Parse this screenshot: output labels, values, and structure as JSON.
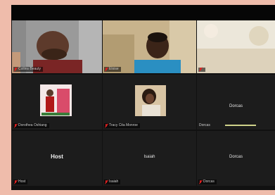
{
  "meeting": {
    "tiles": [
      {
        "id": "video-1",
        "name": "Collins Beauty",
        "muted": true
      },
      {
        "id": "video-2",
        "name": "Eloise",
        "muted": true
      },
      {
        "id": "video-3",
        "name": "",
        "muted": true
      },
      {
        "id": "avatar-1",
        "name": "Dorothea Oshiang",
        "muted": true
      },
      {
        "id": "avatar-2",
        "name": "Tracy Cita Monroe",
        "muted": true
      },
      {
        "id": "name-1",
        "center_label": "Dorcas",
        "name": "Dorcas",
        "muted": false
      },
      {
        "id": "host",
        "center_label": "Host",
        "name": "Host",
        "muted": true
      },
      {
        "id": "name-2",
        "center_label": "Isaiah",
        "name": "Isaiah",
        "muted": true
      },
      {
        "id": "name-3",
        "center_label": "Dorcas",
        "name": "Dorcas",
        "muted": true
      }
    ]
  },
  "colors": {
    "frame_background": "#efbcab",
    "tile_background": "#1c1c1c",
    "mute_red": "#e02020",
    "active_speaker": "#cfd28a"
  }
}
